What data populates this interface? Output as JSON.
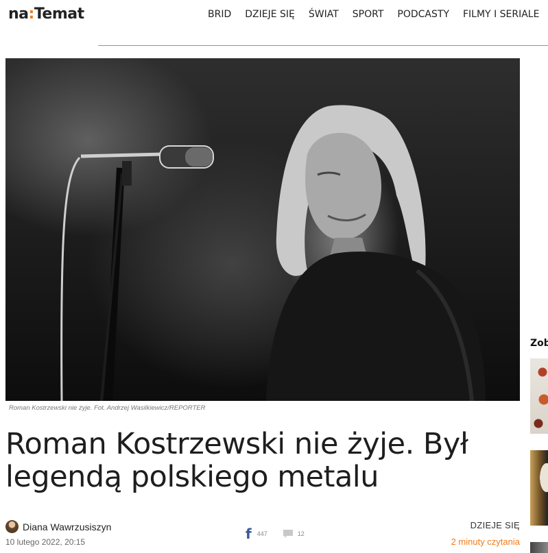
{
  "header": {
    "logo_left": "na",
    "logo_colon": ":",
    "logo_right": "Temat",
    "nav": [
      "BRID",
      "DZIEJE SIĘ",
      "ŚWIAT",
      "SPORT",
      "PODCASTY",
      "FILMY I SERIALE"
    ]
  },
  "article": {
    "image_caption": "Roman Kostrzewski nie żyje. Fot. Andrzej Wasilkiewicz/REPORTER",
    "title": "Roman Kostrzewski nie żyje. Był legendą polskiego metalu",
    "author": "Diana Wawrzusiszyn",
    "date": "10 lutego 2022, 20:15",
    "facebook_shares": "447",
    "comments": "12",
    "category": "DZIEJE SIĘ",
    "read_time": "2 minuty czytania"
  },
  "sidebar": {
    "heading": "Zob"
  },
  "colors": {
    "accent": "#f07c1b",
    "facebook": "#3b5998"
  },
  "icons": [
    "facebook-icon",
    "comment-icon",
    "avatar"
  ]
}
